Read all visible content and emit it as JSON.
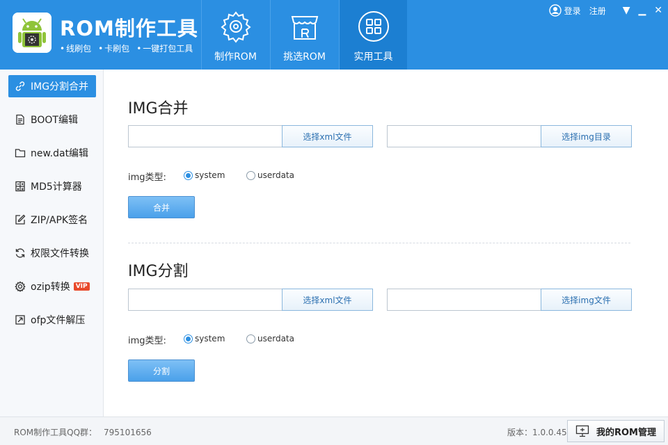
{
  "app": {
    "title": "ROM制作工具",
    "subtitle_items": [
      "线刷包",
      "卡刷包",
      "一键打包工具"
    ]
  },
  "nav": [
    {
      "label": "制作ROM",
      "icon": "gear-icon"
    },
    {
      "label": "挑选ROM",
      "icon": "store-icon"
    },
    {
      "label": "实用工具",
      "icon": "grid-icon",
      "active": true
    }
  ],
  "user": {
    "login": "登录",
    "register": "注册"
  },
  "sidebar": {
    "items": [
      {
        "label": "IMG分割合并",
        "icon": "link-icon",
        "active": true
      },
      {
        "label": "BOOT编辑",
        "icon": "document-icon"
      },
      {
        "label": "new.dat编辑",
        "icon": "folder-icon"
      },
      {
        "label": "MD5计算器",
        "icon": "calculator-icon"
      },
      {
        "label": "ZIP/APK签名",
        "icon": "edit-icon"
      },
      {
        "label": "权限文件转换",
        "icon": "refresh-icon"
      },
      {
        "label": "ozip转换",
        "icon": "gear-small-icon",
        "badge": "VIP"
      },
      {
        "label": "ofp文件解压",
        "icon": "extract-icon"
      }
    ]
  },
  "merge": {
    "title": "IMG合并",
    "xml_value": "",
    "xml_button": "选择xml文件",
    "img_value": "",
    "img_button": "选择img目录",
    "type_label": "img类型:",
    "options": [
      "system",
      "userdata"
    ],
    "selected": "system",
    "action": "合并"
  },
  "split": {
    "title": "IMG分割",
    "xml_value": "",
    "xml_button": "选择xml文件",
    "img_value": "",
    "img_button": "选择img文件",
    "type_label": "img类型:",
    "options": [
      "system",
      "userdata"
    ],
    "selected": "system",
    "action": "分割"
  },
  "footer": {
    "qq_label": "ROM制作工具QQ群：",
    "qq_number": "795101656",
    "version": "版本：1.0.0.45",
    "manage_button": "我的ROM管理"
  },
  "colors": {
    "brand": "#2b8fe2",
    "vip": "#e84a2b"
  }
}
